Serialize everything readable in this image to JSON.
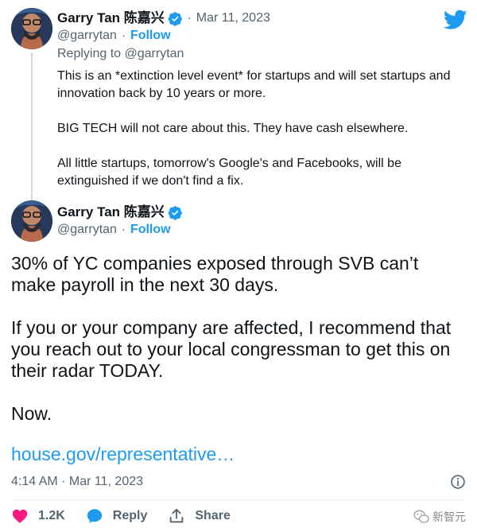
{
  "reply_tweet": {
    "author_name": "Garry Tan 陈嘉兴",
    "handle": "@garrytan",
    "follow_label": "Follow",
    "separator": "·",
    "date": "Mar 11, 2023",
    "replying_to": "Replying to @garrytan",
    "paragraphs": [
      "This is an *extinction level event* for startups and will set startups and innovation back by 10 years or more.",
      "BIG TECH will not care about this. They have cash elsewhere.",
      "All little startups, tomorrow's Google's and Facebooks, will be extinguished if we don't find a fix."
    ]
  },
  "main_tweet": {
    "author_name": "Garry Tan 陈嘉兴",
    "handle": "@garrytan",
    "follow_label": "Follow",
    "separator": "·",
    "paragraphs": [
      "30% of YC companies exposed through SVB can’t make payroll in the next 30 days.",
      "If you or your company are affected, I recommend that you reach out to your local congressman to get this on their radar TODAY.",
      "Now."
    ],
    "link_text": "house.gov/representative…",
    "timestamp": "4:14 AM · Mar 11, 2023"
  },
  "actions": {
    "like_count": "1.2K",
    "reply_label": "Reply",
    "share_label": "Share"
  },
  "watermark": {
    "text": "新智元"
  },
  "colors": {
    "brand_blue": "#1d9bf0",
    "like_pink": "#f91880",
    "text_primary": "#0f1419",
    "text_secondary": "#536471"
  },
  "icons": [
    "twitter-logo-icon",
    "verified-badge-icon",
    "info-icon",
    "heart-icon",
    "reply-bubble-icon",
    "share-icon",
    "wechat-icon"
  ]
}
